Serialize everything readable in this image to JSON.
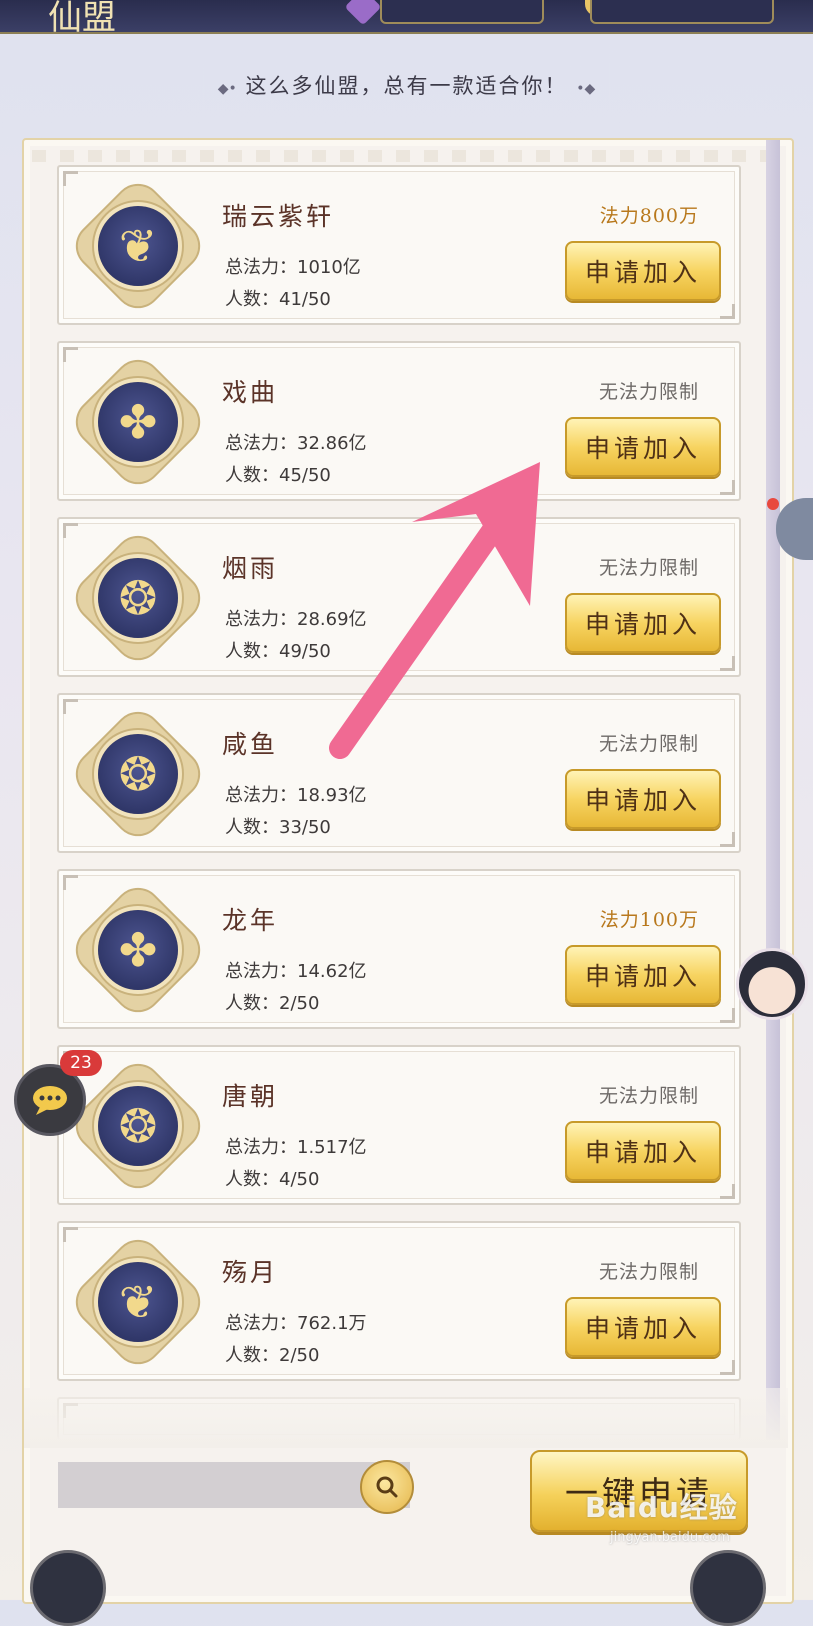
{
  "header": {
    "title": "仙盟"
  },
  "slogan": {
    "left_ornament": "◆•",
    "text": "这么多仙盟，总有一款适合你！",
    "right_ornament": "•◆"
  },
  "guilds": [
    {
      "name": "瑞云紫轩",
      "power_label": "总法力：",
      "power": "1010亿",
      "members_label": "人数：",
      "members": "41/50",
      "requirement": "法力800万",
      "requirement_color": "#b8781c",
      "join_label": "申请加入",
      "emblem": "phoenix-emblem-icon"
    },
    {
      "name": "戏曲",
      "power_label": "总法力：",
      "power": "32.86亿",
      "members_label": "人数：",
      "members": "45/50",
      "requirement": "无法力限制",
      "requirement_color": "#6e6a68",
      "join_label": "申请加入",
      "emblem": "dragon-emblem-icon"
    },
    {
      "name": "烟雨",
      "power_label": "总法力：",
      "power": "28.69亿",
      "members_label": "人数：",
      "members": "49/50",
      "requirement": "无法力限制",
      "requirement_color": "#6e6a68",
      "join_label": "申请加入",
      "emblem": "crane-emblem-icon"
    },
    {
      "name": "咸鱼",
      "power_label": "总法力：",
      "power": "18.93亿",
      "members_label": "人数：",
      "members": "33/50",
      "requirement": "无法力限制",
      "requirement_color": "#6e6a68",
      "join_label": "申请加入",
      "emblem": "crane-emblem-icon"
    },
    {
      "name": "龙年",
      "power_label": "总法力：",
      "power": "14.62亿",
      "members_label": "人数：",
      "members": "2/50",
      "requirement": "法力100万",
      "requirement_color": "#b8781c",
      "join_label": "申请加入",
      "emblem": "dragon-emblem-icon"
    },
    {
      "name": "唐朝",
      "power_label": "总法力：",
      "power": "1.517亿",
      "members_label": "人数：",
      "members": "4/50",
      "requirement": "无法力限制",
      "requirement_color": "#6e6a68",
      "join_label": "申请加入",
      "emblem": "crane-emblem-icon"
    },
    {
      "name": "殇月",
      "power_label": "总法力：",
      "power": "762.1万",
      "members_label": "人数：",
      "members": "2/50",
      "requirement": "无法力限制",
      "requirement_color": "#6e6a68",
      "join_label": "申请加入",
      "emblem": "phoenix-emblem-icon"
    }
  ],
  "footer": {
    "search_placeholder": "",
    "search_icon": "search-icon",
    "apply_all_label": "一键申请"
  },
  "chat": {
    "badge_count": "23",
    "icon": "chat-bubble-icon"
  },
  "watermark": {
    "brand": "Baidu经验",
    "url": "jingyan.baidu.com"
  },
  "colors": {
    "accent_gold": "#f5d15a",
    "emblem_navy": "#303769",
    "arrow_pink": "#f06a93"
  }
}
